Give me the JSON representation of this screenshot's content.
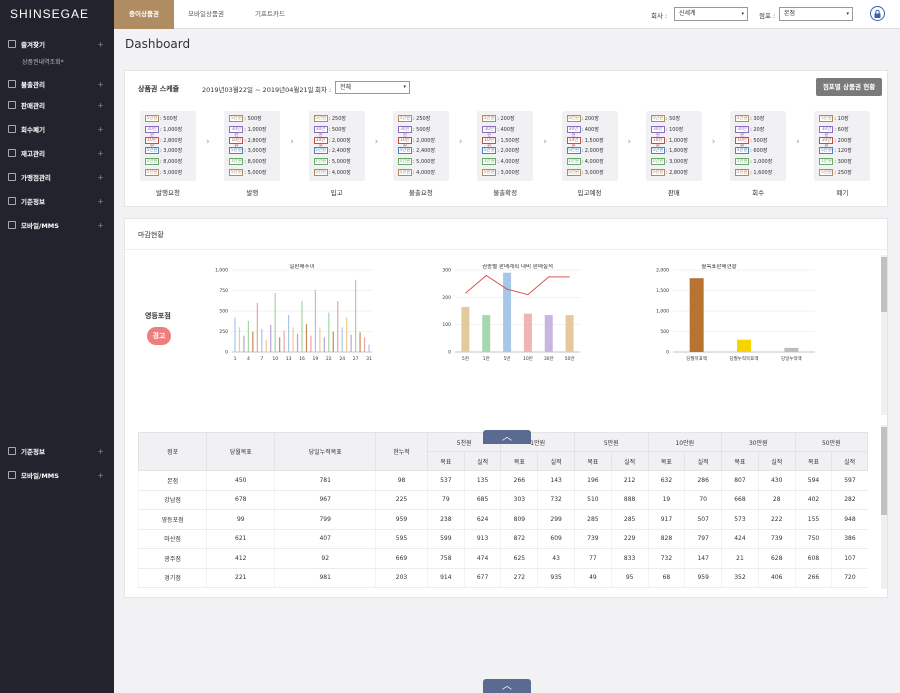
{
  "app": {
    "logo": "SHINSEGAE",
    "page_title": "Dashboard"
  },
  "sidebar": {
    "items": [
      {
        "label": "즐겨찾기",
        "icon": "star-icon"
      },
      {
        "label": "불출관리",
        "icon": "box-icon"
      },
      {
        "label": "판매관리",
        "icon": "monitor-icon"
      },
      {
        "label": "회수폐기",
        "icon": "card-icon"
      },
      {
        "label": "재고관리",
        "icon": "stack-icon"
      },
      {
        "label": "가맹점관리",
        "icon": "store-icon"
      },
      {
        "label": "기준정보",
        "icon": "gear-icon"
      },
      {
        "label": "모바일/MMS",
        "icon": "mail-icon"
      }
    ],
    "sub_item": "상품권내역조회*",
    "bottom_items": [
      {
        "label": "기준정보",
        "icon": "gear-icon"
      },
      {
        "label": "모바일/MMS",
        "icon": "mail-icon"
      }
    ],
    "plus": "+"
  },
  "topbar": {
    "tabs": [
      "종이상품권",
      "모바일상품권",
      "기프트카드"
    ],
    "company_label": "회사 :",
    "company_value": "신세계",
    "store_label": "점포 :",
    "store_value": "본점",
    "caret": "▾"
  },
  "schedule": {
    "title": "상품권 스케줄",
    "period": "2019년03월22일 ~ 2019년04월21일",
    "round_label": "회차 :",
    "round_value": "전체",
    "store_button": "점포별 상품권 현황",
    "stages": [
      {
        "label": "발행요청",
        "rows": [
          [
            "5만원",
            "500장"
          ],
          [
            "30만원",
            "1,000장"
          ],
          [
            "10만원",
            "2,800장"
          ],
          [
            "5만원",
            "3,000장"
          ],
          [
            "1만원",
            "8,000장"
          ],
          [
            "5천원",
            "5,000장"
          ]
        ]
      },
      {
        "label": "발행",
        "rows": [
          [
            "5만원",
            "500장"
          ],
          [
            "30만원",
            "1,000장"
          ],
          [
            "10만원",
            "2,800장"
          ],
          [
            "5만원",
            "3,000장"
          ],
          [
            "1만원",
            "8,000장"
          ],
          [
            "5천원",
            "5,000장"
          ]
        ]
      },
      {
        "label": "입고",
        "rows": [
          [
            "5만원",
            "250장"
          ],
          [
            "30만원",
            "500장"
          ],
          [
            "10만원",
            "2,000장"
          ],
          [
            "5만원",
            "2,400장"
          ],
          [
            "1만원",
            "5,000장"
          ],
          [
            "5천원",
            "4,000장"
          ]
        ]
      },
      {
        "label": "불출요청",
        "rows": [
          [
            "5만원",
            "250장"
          ],
          [
            "30만원",
            "500장"
          ],
          [
            "10만원",
            "2,000장"
          ],
          [
            "5만원",
            "2,400장"
          ],
          [
            "1만원",
            "5,000장"
          ],
          [
            "5천원",
            "4,000장"
          ]
        ]
      },
      {
        "label": "불출확정",
        "rows": [
          [
            "5만원",
            "200장"
          ],
          [
            "30만원",
            "400장"
          ],
          [
            "10만원",
            "1,500장"
          ],
          [
            "5만원",
            "2,000장"
          ],
          [
            "1만원",
            "4,000장"
          ],
          [
            "5천원",
            "3,000장"
          ]
        ]
      },
      {
        "label": "입고예정",
        "rows": [
          [
            "5만원",
            "200장"
          ],
          [
            "30만원",
            "400장"
          ],
          [
            "10만원",
            "1,500장"
          ],
          [
            "5만원",
            "2,000장"
          ],
          [
            "1만원",
            "4,000장"
          ],
          [
            "5천원",
            "3,000장"
          ]
        ]
      },
      {
        "label": "판매",
        "rows": [
          [
            "5만원",
            "50장"
          ],
          [
            "30만원",
            "100장"
          ],
          [
            "10만원",
            "1,000장"
          ],
          [
            "5만원",
            "1,800장"
          ],
          [
            "1만원",
            "3,000장"
          ],
          [
            "5천원",
            "2,800장"
          ]
        ]
      },
      {
        "label": "회수",
        "rows": [
          [
            "5만원",
            "30장"
          ],
          [
            "30만원",
            "20장"
          ],
          [
            "10만원",
            "500장"
          ],
          [
            "5만원",
            "600장"
          ],
          [
            "1만원",
            "1,000장"
          ],
          [
            "5천원",
            "1,600장"
          ]
        ]
      },
      {
        "label": "폐기",
        "rows": [
          [
            "5만원",
            "10장"
          ],
          [
            "30만원",
            "60장"
          ],
          [
            "10만원",
            "200장"
          ],
          [
            "5만원",
            "120장"
          ],
          [
            "1만원",
            "300장"
          ],
          [
            "5천원",
            "250장"
          ]
        ]
      }
    ],
    "arrow": "›"
  },
  "closing": {
    "title": "마감현황",
    "store_name": "영등포점",
    "warning": "경고"
  },
  "colors": {
    "accent": "#b08c63",
    "sidebar": "#23232d",
    "warn": "#ee7e7c",
    "button": "#5b6a90"
  },
  "chart_data": [
    {
      "type": "bar",
      "title": "일판매추이",
      "x_ticks": [
        "1",
        "4",
        "7",
        "10",
        "13",
        "16",
        "19",
        "22",
        "24",
        "27",
        "31"
      ],
      "ylim": [
        0,
        1000
      ],
      "y_ticks": [
        "0",
        "250",
        "500",
        "750",
        "1,000"
      ],
      "series": [
        {
          "values": [
            420,
            300,
            200,
            380,
            250,
            600,
            280,
            150,
            330,
            720,
            180,
            260,
            450,
            300,
            220,
            620,
            340,
            200,
            760,
            300,
            180,
            480,
            250,
            620,
            300,
            420,
            210,
            880,
            240,
            180,
            90
          ]
        },
        {
          "values": [
            0,
            0,
            0,
            0,
            0,
            0,
            0,
            0,
            0,
            0,
            0,
            0,
            0,
            0,
            0,
            0,
            0,
            0,
            0,
            0,
            0,
            0,
            0,
            0,
            0,
            0,
            0,
            0,
            0,
            0,
            0
          ]
        }
      ]
    },
    {
      "type": "bar",
      "title": "권종별 판매계획 대비 판매실적",
      "categories": [
        "5천",
        "1만",
        "5만",
        "10만",
        "30만",
        "50만"
      ],
      "values": [
        165,
        135,
        290,
        140,
        135,
        135
      ],
      "line": [
        215,
        280,
        230,
        210,
        275,
        275
      ],
      "ylim": [
        0,
        300
      ],
      "y_ticks": [
        "0",
        "100",
        "200",
        "300"
      ]
    },
    {
      "type": "bar",
      "title": "월목표판매현황",
      "categories": [
        "당월목표액",
        "당월누적목표액",
        "당일누적액"
      ],
      "values": [
        1800,
        300,
        100
      ],
      "ylim": [
        0,
        2000
      ],
      "y_ticks": [
        "0",
        "500",
        "1,000",
        "1,500",
        "2,000"
      ]
    }
  ],
  "table": {
    "header1": [
      "점포",
      "당월목표",
      "당일누적목표",
      "현누적",
      "5천원",
      "1만원",
      "5만원",
      "10만원",
      "30만원",
      "50만원"
    ],
    "header2": [
      "목표",
      "실적",
      "목표",
      "실적",
      "목표",
      "실적",
      "목표",
      "실적",
      "목표",
      "실적",
      "목표",
      "실적"
    ],
    "rows": [
      [
        "본점",
        "450",
        "781",
        "98",
        "537",
        "135",
        "266",
        "143",
        "196",
        "212",
        "632",
        "286",
        "807",
        "430",
        "594",
        "597"
      ],
      [
        "강남점",
        "678",
        "967",
        "225",
        "79",
        "685",
        "303",
        "732",
        "510",
        "888",
        "19",
        "70",
        "668",
        "28",
        "402",
        "282"
      ],
      [
        "영등포점",
        "99",
        "799",
        "959",
        "238",
        "624",
        "809",
        "299",
        "285",
        "285",
        "917",
        "507",
        "573",
        "222",
        "155",
        "948"
      ],
      [
        "마산점",
        "621",
        "407",
        "595",
        "599",
        "913",
        "872",
        "609",
        "739",
        "229",
        "828",
        "797",
        "424",
        "739",
        "750",
        "386"
      ],
      [
        "광주점",
        "412",
        "92",
        "669",
        "758",
        "474",
        "625",
        "43",
        "77",
        "833",
        "732",
        "147",
        "21",
        "628",
        "608",
        "107"
      ],
      [
        "경기점",
        "221",
        "981",
        "203",
        "914",
        "677",
        "272",
        "935",
        "49",
        "95",
        "68",
        "959",
        "352",
        "406",
        "266",
        "720"
      ]
    ]
  },
  "ui": {
    "up_arrow": "︿"
  }
}
